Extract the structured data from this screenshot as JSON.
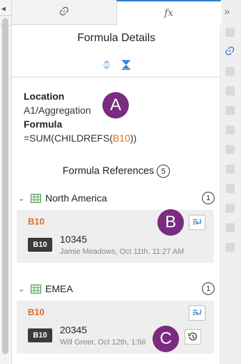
{
  "tabs": [
    {
      "label": "",
      "icon": "link-icon"
    },
    {
      "label": "fx",
      "icon": "function-icon"
    }
  ],
  "panel_title": "Formula Details",
  "details": {
    "location_label": "Location",
    "location_value": "A1/Aggregation",
    "formula_label": "Formula",
    "formula_prefix": "=SUM(CHILDREFS(",
    "formula_ref": "B10",
    "formula_suffix": "))"
  },
  "references": {
    "title": "Formula References",
    "count": "5"
  },
  "groups": [
    {
      "name": "North America",
      "count": "1",
      "cell": "B10",
      "chip": "B10",
      "value": "10345",
      "meta": "Jamie Meadows, Oct 11th, 11:27 AM"
    },
    {
      "name": "EMEA",
      "count": "1",
      "cell": "B10",
      "chip": "B10",
      "value": "20345",
      "meta": "Will Greer, Oct 12th, 1:56"
    }
  ],
  "callouts": {
    "a": "A",
    "b": "B",
    "c": "C"
  },
  "colors": {
    "accent": "#2b7cd3",
    "cell_ref": "#e07020",
    "callout": "#7a2c80",
    "chip": "#3a3a3a"
  }
}
